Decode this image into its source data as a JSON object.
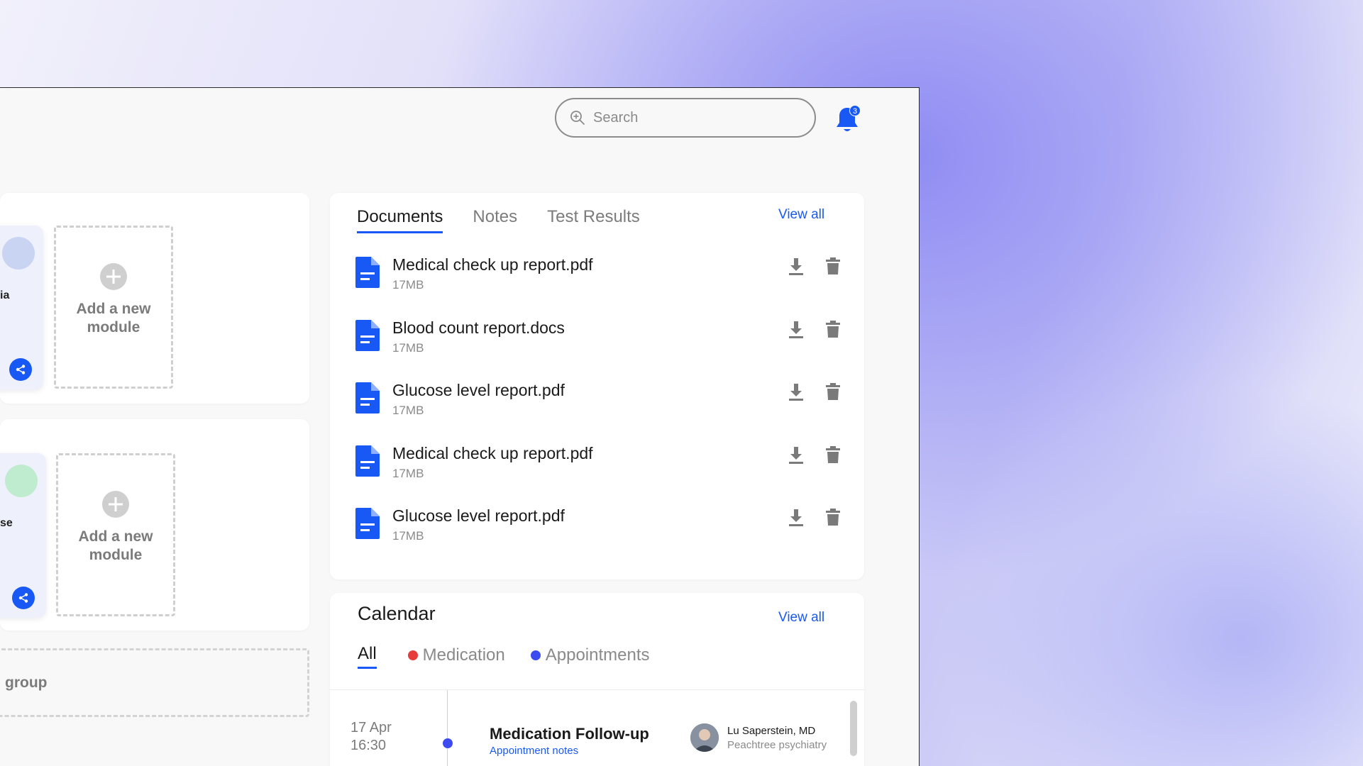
{
  "header": {
    "search_placeholder": "Search",
    "notification_count": "3",
    "accent_color": "#1859f5"
  },
  "modules": {
    "group1": {
      "tile_label": "ia",
      "add_label_1": "Add a new",
      "add_label_2": "module"
    },
    "group2": {
      "tile_label": "se",
      "add_label_1": "Add a new",
      "add_label_2": "module"
    },
    "add_group_label": "group"
  },
  "documents": {
    "tabs": [
      {
        "label": "Documents",
        "active": true
      },
      {
        "label": "Notes",
        "active": false
      },
      {
        "label": "Test Results",
        "active": false
      }
    ],
    "view_all": "View all",
    "items": [
      {
        "name": "Medical check up report.pdf",
        "size": "17MB"
      },
      {
        "name": "Blood count report.docs",
        "size": "17MB"
      },
      {
        "name": "Glucose level report.pdf",
        "size": "17MB"
      },
      {
        "name": "Medical check up report.pdf",
        "size": "17MB"
      },
      {
        "name": "Glucose level report.pdf",
        "size": "17MB"
      }
    ]
  },
  "calendar": {
    "title": "Calendar",
    "view_all": "View all",
    "filters": [
      {
        "label": "All",
        "color": null
      },
      {
        "label": "Medication",
        "color": "#e83b3b"
      },
      {
        "label": "Appointments",
        "color": "#3d4cf0"
      }
    ],
    "events": [
      {
        "date": "17 Apr",
        "time": "16:30",
        "title": "Medication Follow-up",
        "link": "Appointment notes",
        "doctor": "Lu Saperstein, MD",
        "organization": "Peachtree psychiatry"
      }
    ]
  }
}
